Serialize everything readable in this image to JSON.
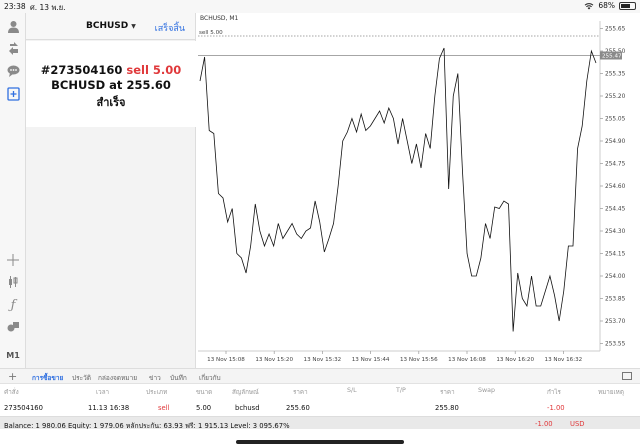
{
  "status_bar": {
    "time": "23:38",
    "date": "ศ. 13 พ.ย.",
    "battery": "68%",
    "battery_level": 0.68
  },
  "toolbar": {
    "m1_label": "M1"
  },
  "order_panel": {
    "symbol": "BCHUSD",
    "done_label": "เสร็จสิ้น",
    "result": {
      "ticket": "#273504160",
      "action": "sell 5.00",
      "symbol": "BCHUSD",
      "at": "at",
      "price": "255.60",
      "status": "สำเร็จ"
    }
  },
  "chart_title": "BCHUSD, M1",
  "chart_data": {
    "type": "line",
    "series": [
      {
        "values": [
          255.3,
          255.46,
          254.97,
          254.95,
          254.55,
          254.52,
          254.36,
          254.45,
          254.15,
          254.12,
          254.02,
          254.2,
          254.48,
          254.3,
          254.2,
          254.28,
          254.2,
          254.35,
          254.25,
          254.3,
          254.35,
          254.28,
          254.25,
          254.3,
          254.32,
          254.5,
          254.36,
          254.16,
          254.25,
          254.35,
          254.6,
          254.9,
          254.96,
          255.05,
          254.96,
          255.08,
          254.97,
          255.0,
          255.05,
          255.1,
          255.02,
          255.12,
          255.05,
          254.88,
          255.05,
          254.9,
          254.75,
          254.88,
          254.72,
          254.95,
          254.85,
          255.2,
          255.45,
          255.52,
          254.58,
          255.2,
          255.35,
          254.7,
          254.15,
          254.0,
          254.0,
          254.12,
          254.35,
          254.25,
          254.46,
          254.45,
          254.5,
          254.48,
          253.63,
          254.02,
          253.85,
          253.8,
          254.0,
          253.8,
          253.8,
          253.9,
          254.0,
          253.87,
          253.7,
          253.9,
          254.2,
          254.2,
          254.85,
          255.0,
          255.3,
          255.5,
          255.42
        ]
      }
    ],
    "markers": {
      "sell_label": "sell 5.00",
      "sell_price": 255.6,
      "bid_label": "255.47",
      "bid_price": 255.47
    },
    "ylim": [
      253.5,
      255.7
    ],
    "y_ticks": [
      "255.65",
      "255.50",
      "255.35",
      "255.20",
      "255.05",
      "254.90",
      "254.75",
      "254.60",
      "254.45",
      "254.30",
      "254.15",
      "254.00",
      "253.85",
      "253.70",
      "253.55"
    ],
    "x_ticks": [
      "13 Nov 15:08",
      "13 Nov 15:20",
      "13 Nov 15:32",
      "13 Nov 15:44",
      "13 Nov 15:56",
      "13 Nov 16:08",
      "13 Nov 16:20",
      "13 Nov 16:32"
    ],
    "grid": false,
    "line_color": "#111111",
    "marker_line_color": "#888888",
    "bid_label_bg": "#8a8a8a"
  },
  "tabs": [
    {
      "label": "การซื้อขาย",
      "active": true
    },
    {
      "label": "ประวัติ",
      "active": false
    },
    {
      "label": "กล่องจดหมาย",
      "active": false
    },
    {
      "label": "ข่าว",
      "active": false
    },
    {
      "label": "บันทึก",
      "active": false
    },
    {
      "label": "เกี่ยวกับ",
      "active": false
    }
  ],
  "table": {
    "headers": [
      "คำสั่ง",
      "เวลา",
      "ประเภท",
      "ขนาด",
      "สัญลักษณ์",
      "ราคา",
      "S/L",
      "T/P",
      "ราคา",
      "Swap",
      "กำไร",
      "หมายเหตุ"
    ],
    "row": {
      "order": "273504160",
      "time": "11.13 16:38",
      "type": "sell",
      "size": "5.00",
      "symbol": "bchusd",
      "price": "255.60",
      "sl": "",
      "tp": "",
      "current": "255.80",
      "swap": "",
      "profit": "-1.00",
      "comment": ""
    }
  },
  "balance": {
    "text": "Balance: 1 980.06 Equity: 1 979.06 หลักประกัน: 63.93 ฟรี: 1 915.13 Level: 3 095.67%",
    "total": "-1.00",
    "currency": "USD"
  },
  "colors": {
    "accent": "#2f6fe0",
    "sell": "#e0393b"
  }
}
